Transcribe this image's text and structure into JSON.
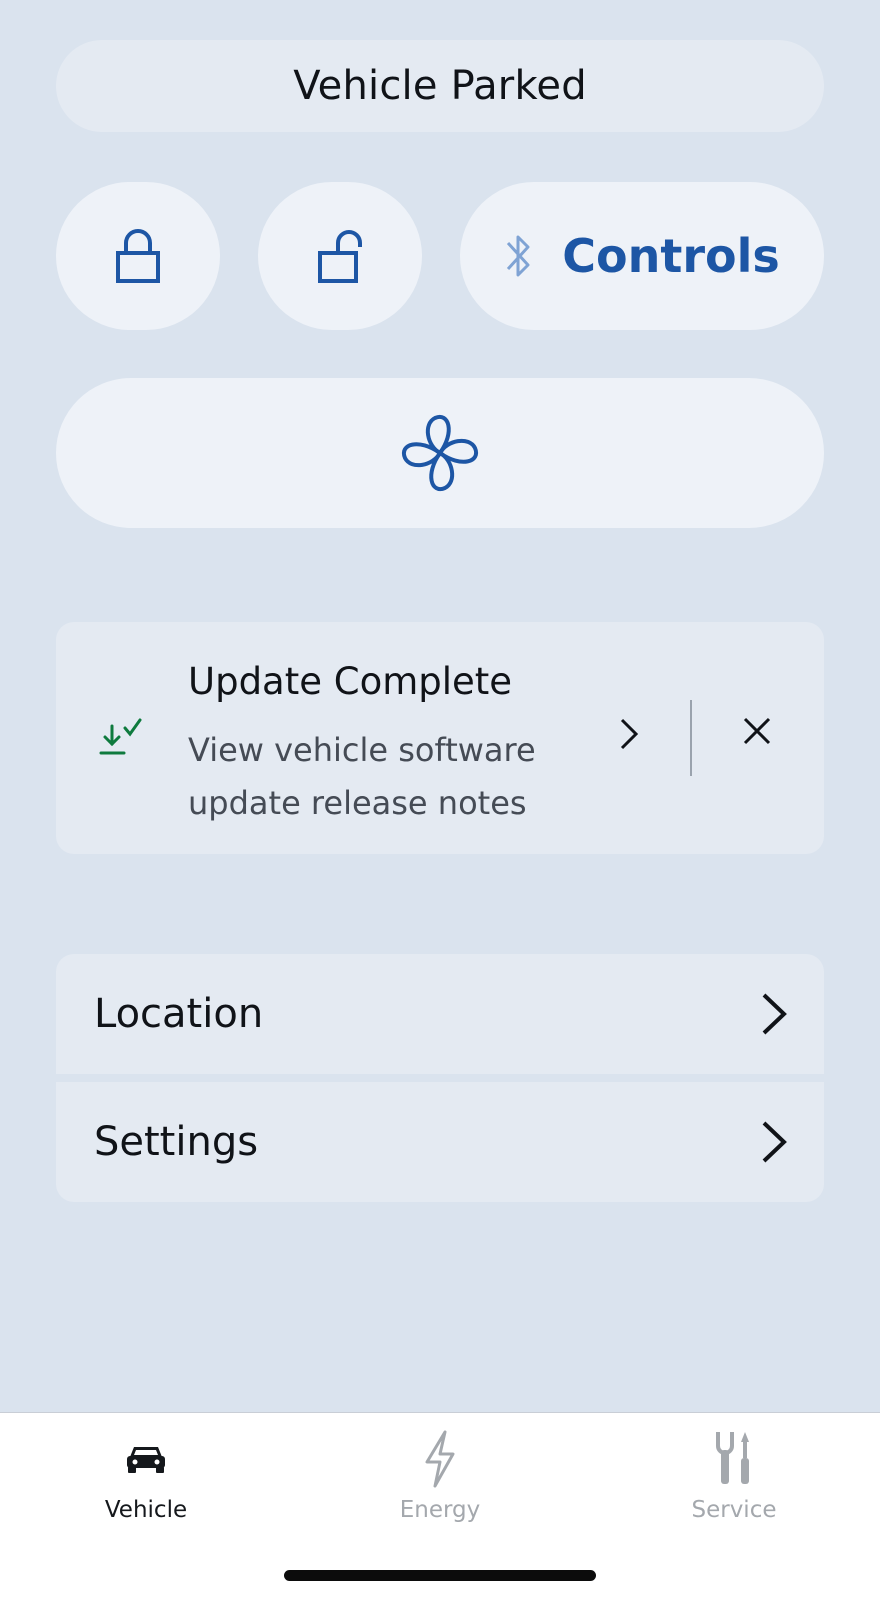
{
  "status": {
    "text": "Vehicle Parked"
  },
  "actions": {
    "lock_icon": "lock-icon",
    "unlock_icon": "unlock-icon",
    "controls_icon": "bluetooth-icon",
    "controls_label": "Controls",
    "climate_icon": "fan-icon"
  },
  "update_card": {
    "icon": "download-check-icon",
    "title": "Update Complete",
    "description": "View vehicle software update release notes"
  },
  "list": {
    "items": [
      {
        "label": "Location"
      },
      {
        "label": "Settings"
      }
    ]
  },
  "bottom_nav": {
    "tabs": [
      {
        "label": "Vehicle",
        "icon": "car-icon",
        "active": true
      },
      {
        "label": "Energy",
        "icon": "lightning-icon",
        "active": false
      },
      {
        "label": "Service",
        "icon": "tools-icon",
        "active": false
      }
    ]
  },
  "colors": {
    "background": "#dae3ee",
    "accent": "#1d56a5",
    "success": "#0e7a3e"
  }
}
